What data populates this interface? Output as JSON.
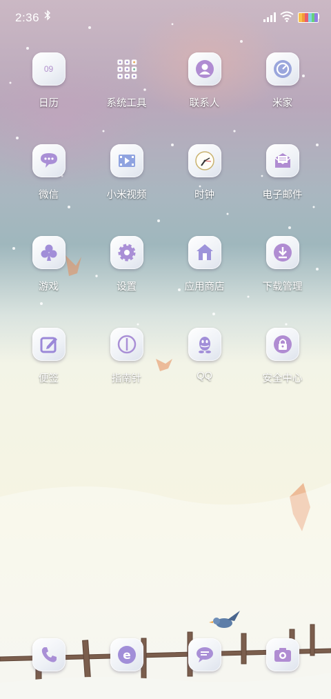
{
  "status_bar": {
    "time": "2:36",
    "bluetooth_icon": "bluetooth-icon",
    "signal_icon": "signal-icon",
    "wifi_icon": "wifi-icon",
    "battery_icon": "battery-icon"
  },
  "apps": [
    {
      "label": "日历",
      "icon": "calendar-icon",
      "icon_text": "09"
    },
    {
      "label": "系统工具",
      "icon": "folder-icon"
    },
    {
      "label": "联系人",
      "icon": "contacts-icon"
    },
    {
      "label": "米家",
      "icon": "mijia-icon"
    },
    {
      "label": "微信",
      "icon": "wechat-icon"
    },
    {
      "label": "小米视频",
      "icon": "video-icon"
    },
    {
      "label": "时钟",
      "icon": "clock-icon"
    },
    {
      "label": "电子邮件",
      "icon": "mail-icon"
    },
    {
      "label": "游戏",
      "icon": "games-icon"
    },
    {
      "label": "设置",
      "icon": "settings-icon"
    },
    {
      "label": "应用商店",
      "icon": "store-icon"
    },
    {
      "label": "下载管理",
      "icon": "download-icon"
    },
    {
      "label": "便签",
      "icon": "notes-icon"
    },
    {
      "label": "指南针",
      "icon": "compass-icon"
    },
    {
      "label": "QQ",
      "icon": "qq-icon"
    },
    {
      "label": "安全中心",
      "icon": "security-icon"
    }
  ],
  "dock": [
    {
      "icon": "phone-icon"
    },
    {
      "icon": "browser-icon"
    },
    {
      "icon": "messages-icon"
    },
    {
      "icon": "camera-icon"
    }
  ],
  "colors": {
    "icon_accent": "#b08cd2",
    "icon_accent_2": "#8fa3e0"
  }
}
